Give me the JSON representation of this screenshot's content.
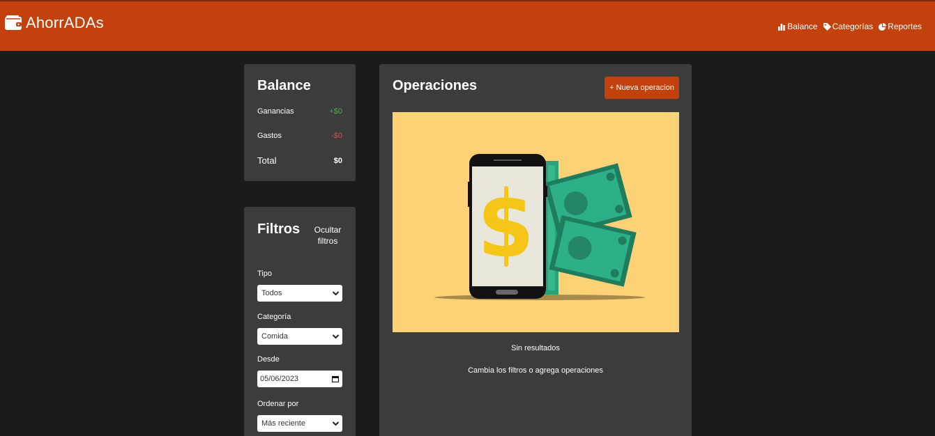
{
  "nav": {
    "brand": "AhorrADAs",
    "links": [
      {
        "label": "Balance",
        "icon": "bar-chart-icon"
      },
      {
        "label": "Categorías",
        "icon": "tag-icon"
      },
      {
        "label": "Reportes",
        "icon": "pie-chart-icon"
      }
    ]
  },
  "balance": {
    "title": "Balance",
    "ganancias_label": "Ganancias",
    "ganancias_value": "+$0",
    "gastos_label": "Gastos",
    "gastos_value": "-$0",
    "total_label": "Total",
    "total_value": "$0"
  },
  "filters": {
    "title": "Filtros",
    "hide_label": "Ocultar filtros",
    "tipo_label": "Tipo",
    "tipo_value": "Todos",
    "categoria_label": "Categoría",
    "categoria_value": "Comida",
    "desde_label": "Desde",
    "desde_value": "05/06/2023",
    "ordenar_label": "Ordenar por",
    "ordenar_value": "Más reciente"
  },
  "operations": {
    "title": "Operaciones",
    "new_button": "+ Nueva operacion",
    "empty_title": "Sin resultados",
    "empty_subtitle": "Cambia los filtros o agrega operaciones"
  },
  "colors": {
    "navbar": "#c2410c",
    "background": "#1b1b1b",
    "card": "#3c3c3c",
    "positive": "#3fb34f",
    "negative": "#e5474b",
    "illustration_bg": "#fdd276"
  }
}
